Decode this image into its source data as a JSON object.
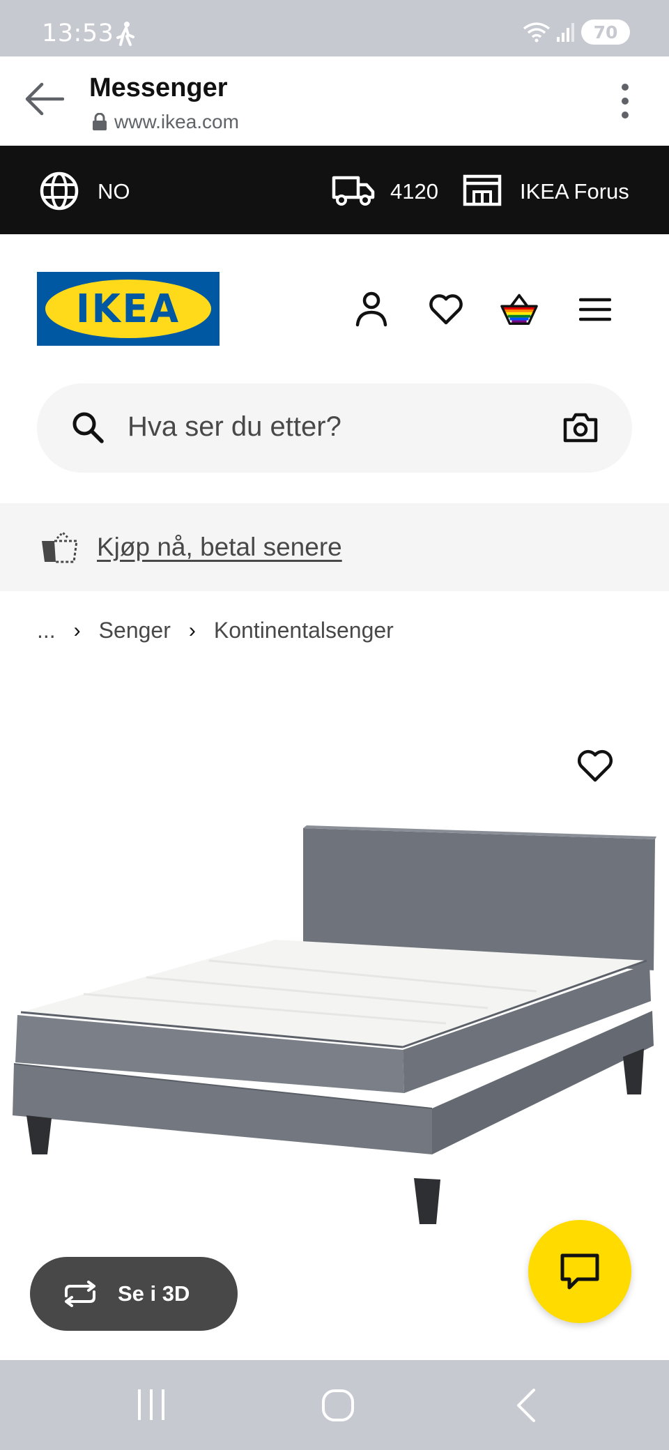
{
  "status": {
    "time": "13:53",
    "battery": "70"
  },
  "browser": {
    "title": "Messenger",
    "url": "www.ikea.com"
  },
  "topbar": {
    "language": "NO",
    "postcode": "4120",
    "store": "IKEA Forus"
  },
  "logo": {
    "text": "IKEA"
  },
  "search": {
    "placeholder": "Hva ser du etter?"
  },
  "promo": {
    "text": "Kjøp nå, betal senere"
  },
  "breadcrumb": {
    "ellipsis": "...",
    "items": [
      "Senger",
      "Kontinentalsenger"
    ]
  },
  "view3d": {
    "label": "Se i 3D"
  },
  "colors": {
    "ikea_blue": "#0058a3",
    "ikea_yellow": "#ffda1a",
    "chat_yellow": "#ffdb00",
    "topbar": "#111111"
  }
}
